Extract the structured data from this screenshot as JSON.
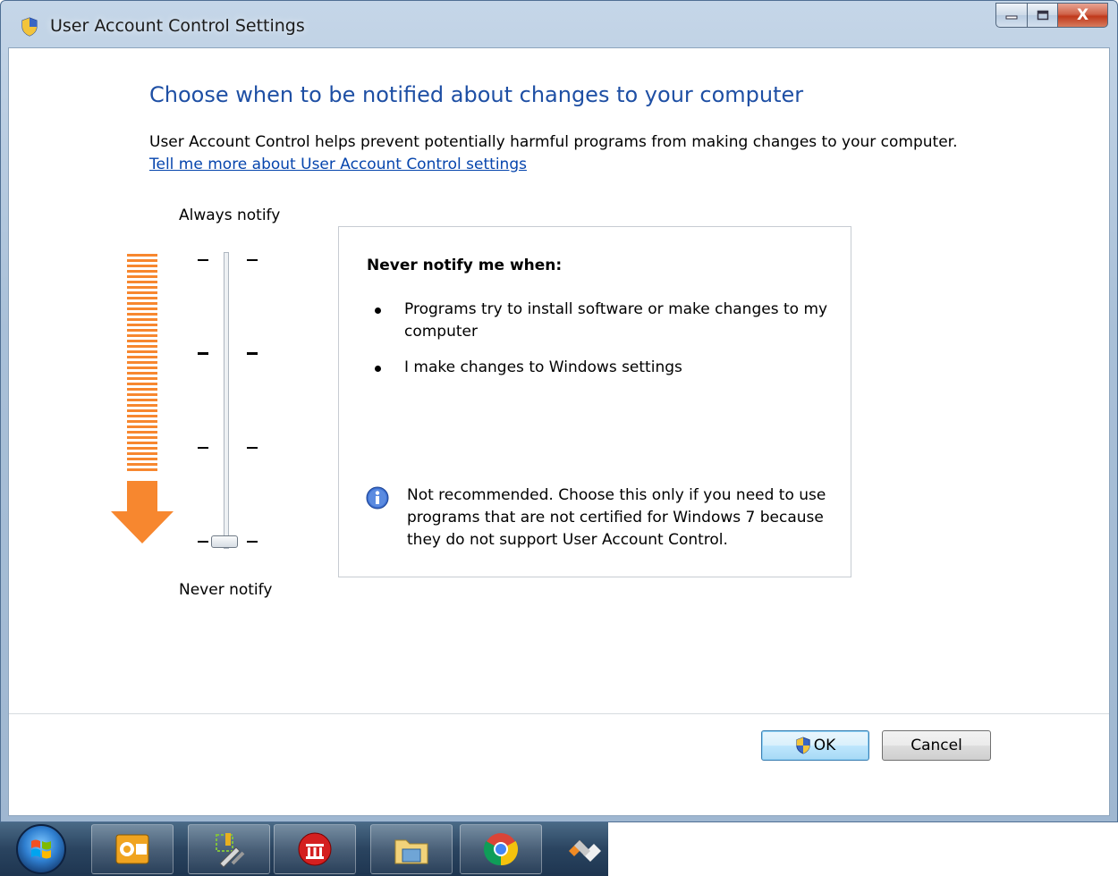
{
  "window": {
    "title": "User Account Control Settings",
    "close_glyph": "X"
  },
  "main": {
    "heading": "Choose when to be notified about changes to your computer",
    "description": "User Account Control helps prevent potentially harmful programs from making changes to your computer.",
    "help_link": "Tell me more about User Account Control settings"
  },
  "slider": {
    "top_label": "Always notify",
    "bottom_label": "Never notify",
    "level": 1,
    "levels_total": 4
  },
  "info_panel": {
    "title": "Never notify me when:",
    "bullets": [
      "Programs try to install software or make changes to my computer",
      "I make changes to Windows settings"
    ],
    "note": "Not recommended. Choose this only if you need to use programs that are not certified for Windows 7 because they do not support User Account Control."
  },
  "buttons": {
    "ok": "OK",
    "cancel": "Cancel"
  },
  "taskbar": {
    "items": [
      "outlook-icon",
      "tools-icon",
      "remote-icon",
      "file-manager-icon",
      "chrome-icon",
      "app-icon"
    ]
  },
  "colors": {
    "heading": "#1e4fa4",
    "link": "#0645ad",
    "arrow": "#f7872f"
  }
}
